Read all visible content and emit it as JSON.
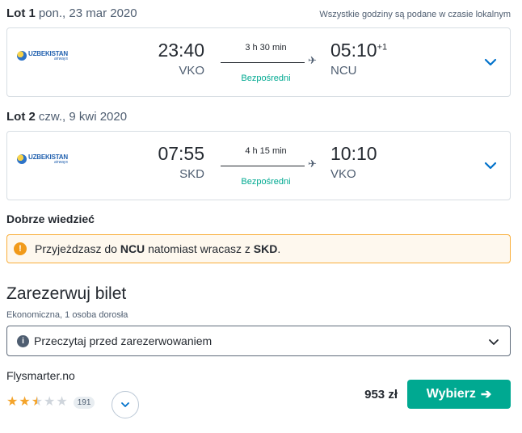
{
  "legs": [
    {
      "label": "Lot 1",
      "date": "pon., 23 mar 2020",
      "airline": "UZBEKISTAN",
      "airline_sub": "airways",
      "dep_time": "23:40",
      "dep_code": "VKO",
      "duration": "3 h 30 min",
      "stops": "Bezpośredni",
      "arr_time": "05:10",
      "arr_day_offset": "+1",
      "arr_code": "NCU"
    },
    {
      "label": "Lot 2",
      "date": "czw., 9 kwi 2020",
      "airline": "UZBEKISTAN",
      "airline_sub": "airways",
      "dep_time": "07:55",
      "dep_code": "SKD",
      "duration": "4 h 15 min",
      "stops": "Bezpośredni",
      "arr_time": "10:10",
      "arr_day_offset": "",
      "arr_code": "VKO"
    }
  ],
  "timezone_note": "Wszystkie godziny są podane w czasie lokalnym",
  "good_to_know": {
    "title": "Dobrze wiedzieć",
    "alert_prefix": "Przyjeżdzasz do",
    "alert_arrival": "NCU",
    "alert_middle": "natomiast wracasz z",
    "alert_return": "SKD",
    "alert_suffix": "."
  },
  "booking": {
    "title": "Zarezerwuj bilet",
    "cabin": "Ekonomiczna, 1 osoba dorosła",
    "info_label": "Przeczytaj przed zarezerwowaniem",
    "provider": "Flysmarter.no",
    "rating_stars": 2.5,
    "rating_max": 5,
    "reviews_count": "191",
    "price": "953 zł",
    "select_label": "Wybierz"
  },
  "colors": {
    "accent": "#00a991",
    "warning": "#f9ae3a",
    "star": "#f4a42b",
    "link_blue": "#0172cb"
  }
}
